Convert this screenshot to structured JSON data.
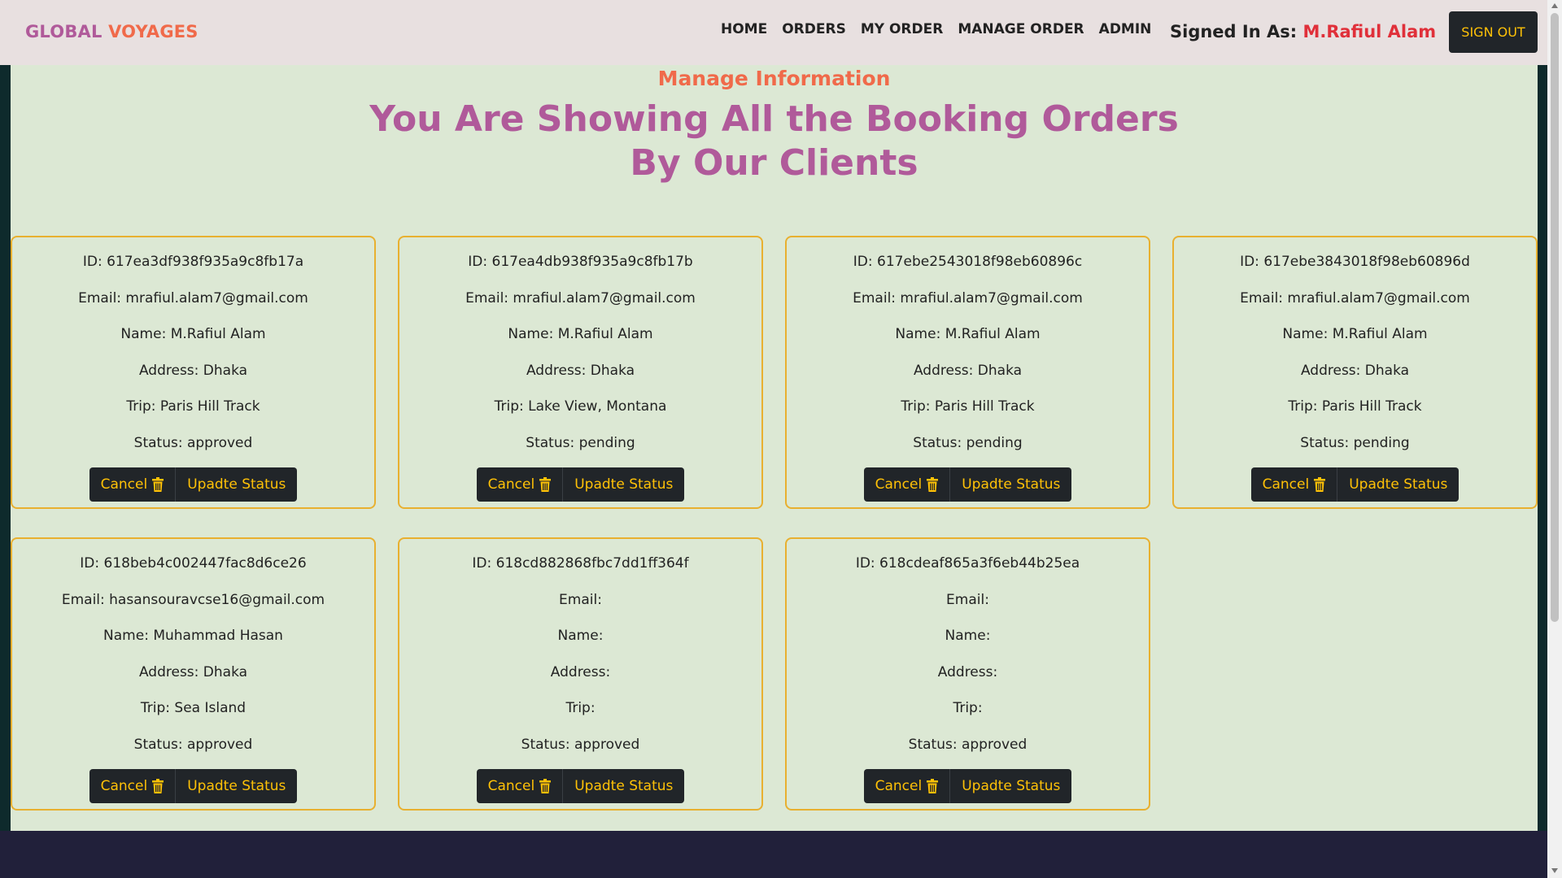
{
  "brand": {
    "part1": "GLOBAL",
    "part2": "VOYAGES"
  },
  "nav": {
    "links": [
      "HOME",
      "ORDERS",
      "MY ORDER",
      "MANAGE ORDER",
      "ADMIN"
    ],
    "signed_label": "Signed In As:",
    "user": "M.Rafiul Alam",
    "signout": "SIGN OUT"
  },
  "page": {
    "subtitle": "Manage Information",
    "title_line1": "You Are Showing All the Booking Orders",
    "title_line2": "By Our Clients"
  },
  "buttons": {
    "cancel": "Cancel",
    "update": "Upadte Status"
  },
  "orders": [
    {
      "id": "ID: 617ea3df938f935a9c8fb17a",
      "email": "Email: mrafiul.alam7@gmail.com",
      "name": "Name: M.Rafiul Alam",
      "address": "Address: Dhaka",
      "trip": "Trip: Paris Hill Track",
      "status": "Status: approved"
    },
    {
      "id": "ID: 617ea4db938f935a9c8fb17b",
      "email": "Email: mrafiul.alam7@gmail.com",
      "name": "Name: M.Rafiul Alam",
      "address": "Address: Dhaka",
      "trip": "Trip: Lake View, Montana",
      "status": "Status: pending"
    },
    {
      "id": "ID: 617ebe2543018f98eb60896c",
      "email": "Email: mrafiul.alam7@gmail.com",
      "name": "Name: M.Rafiul Alam",
      "address": "Address: Dhaka",
      "trip": "Trip: Paris Hill Track",
      "status": "Status: pending"
    },
    {
      "id": "ID: 617ebe3843018f98eb60896d",
      "email": "Email: mrafiul.alam7@gmail.com",
      "name": "Name: M.Rafiul Alam",
      "address": "Address: Dhaka",
      "trip": "Trip: Paris Hill Track",
      "status": "Status: pending"
    },
    {
      "id": "ID: 618beb4c002447fac8d6ce26",
      "email": "Email: hasansouravcse16@gmail.com",
      "name": "Name: Muhammad Hasan",
      "address": "Address: Dhaka",
      "trip": "Trip: Sea Island",
      "status": "Status: approved"
    },
    {
      "id": "ID: 618cd882868fbc7dd1ff364f",
      "email": "Email:",
      "name": "Name:",
      "address": "Address:",
      "trip": "Trip:",
      "status": "Status: approved"
    },
    {
      "id": "ID: 618cdeaf865a3f6eb44b25ea",
      "email": "Email:",
      "name": "Name:",
      "address": "Address:",
      "trip": "Trip:",
      "status": "Status: approved"
    }
  ],
  "colors": {
    "brand_purple": "#b05a9a",
    "brand_orange": "#f06a4a",
    "user_red": "#e0303a",
    "button_dark": "#212529",
    "button_text": "#ffc107",
    "card_border": "#e8b030",
    "content_bg": "#dce8d4"
  },
  "icons": {
    "cancel_icon": "trash-icon"
  }
}
